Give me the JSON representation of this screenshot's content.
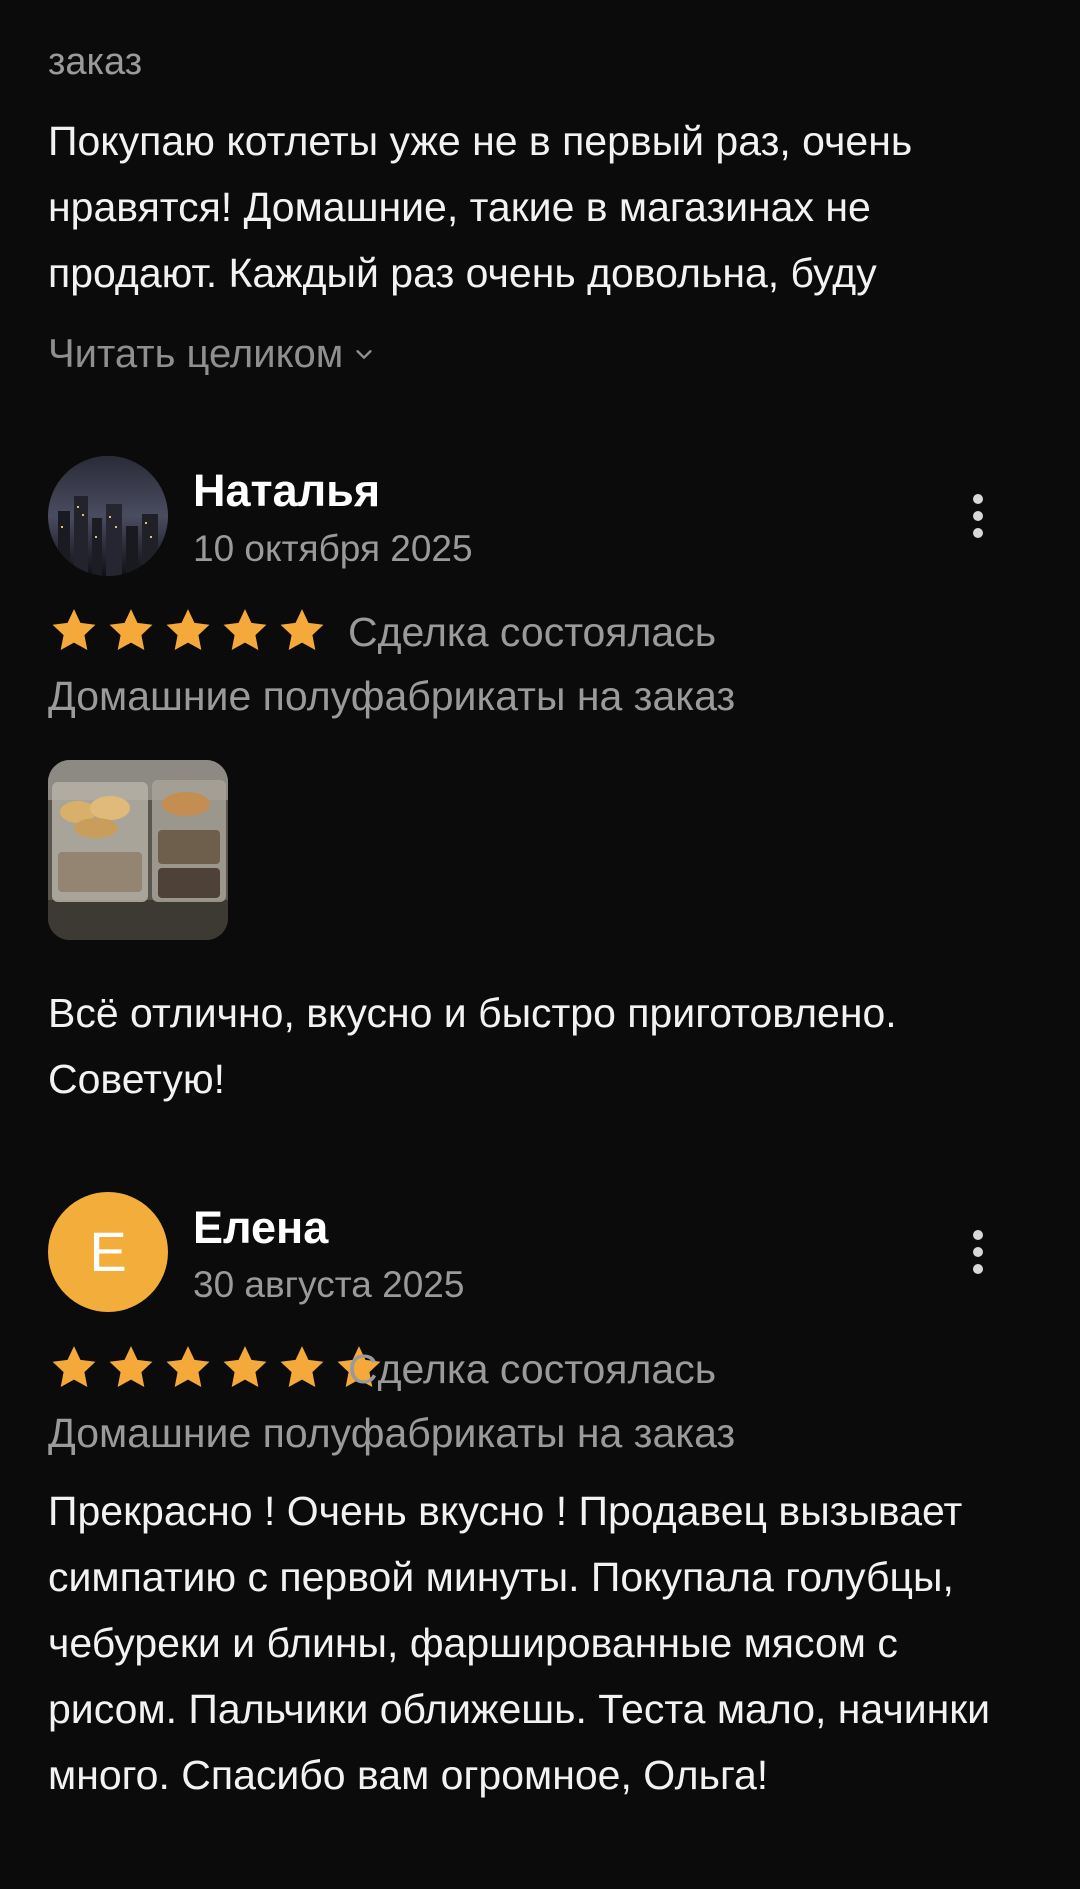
{
  "first_review": {
    "category": "заказ",
    "text": "Покупаю котлеты уже не в первый раз, очень нравятся! Домашние, такие в магазинах не продают. Каждый раз очень довольна, буду",
    "read_more": "Читать целиком"
  },
  "reviews": [
    {
      "name": "Наталья",
      "date": "10 октября 2025",
      "rating": 5,
      "deal_status": "Сделка состоялась",
      "category": "Домашние полуфабрикаты на заказ",
      "text": "Всё отлично, вкусно и  быстро приготовлено. Советую!"
    },
    {
      "name": "Елена",
      "avatar_letter": "Е",
      "date": "30 августа 2025",
      "rating": 5,
      "deal_status": "Сделка состоялась",
      "category": "Домашние полуфабрикаты на заказ",
      "text": "Прекрасно ! Очень вкусно ! Продавец вызывает симпатию с первой минуты. Покупала голубцы, чебуреки и блины, фаршированные мясом с рисом. Пальчики оближешь. Теста мало, начинки много. Спасибо вам огромное, Ольга!"
    }
  ],
  "colors": {
    "background": "#0b0b0c",
    "star": "#f5a93a",
    "avatar_letter_bg": "#f2ad3a",
    "secondary_text": "#9a9a9a"
  },
  "icons": {
    "more": "vertical-dots-icon",
    "star": "star-icon",
    "read_more": "chevron-down-icon"
  }
}
